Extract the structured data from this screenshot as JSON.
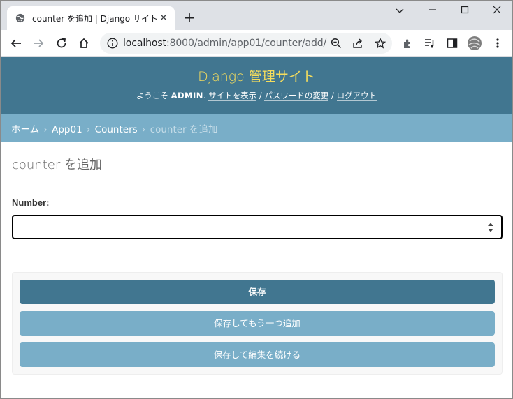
{
  "browser": {
    "tab_title": "counter を追加 | Django サイト管理",
    "new_tab_label": "+",
    "url_host": "localhost",
    "url_path": ":8000/admin/app01/counter/add/"
  },
  "header": {
    "branding": "Django 管理サイト",
    "welcome": "ようこそ",
    "username": "ADMIN",
    "view_site": "サイトを表示",
    "change_password": "パスワードの変更",
    "logout": "ログアウト",
    "separator": "/"
  },
  "breadcrumbs": {
    "home": "ホーム",
    "app": "App01",
    "model": "Counters",
    "current": "counter を追加",
    "separator": "›"
  },
  "main": {
    "title": "counter を追加",
    "field_label": "Number:",
    "field_value": ""
  },
  "actions": {
    "save": "保存",
    "save_add_another": "保存してもう一つ追加",
    "save_continue": "保存して編集を続ける"
  },
  "colors": {
    "header_bg": "#417690",
    "branding": "#f5dd5d",
    "breadcrumbs_bg": "#79aec8",
    "primary_button": "#417690",
    "secondary_button": "#79aec8"
  }
}
